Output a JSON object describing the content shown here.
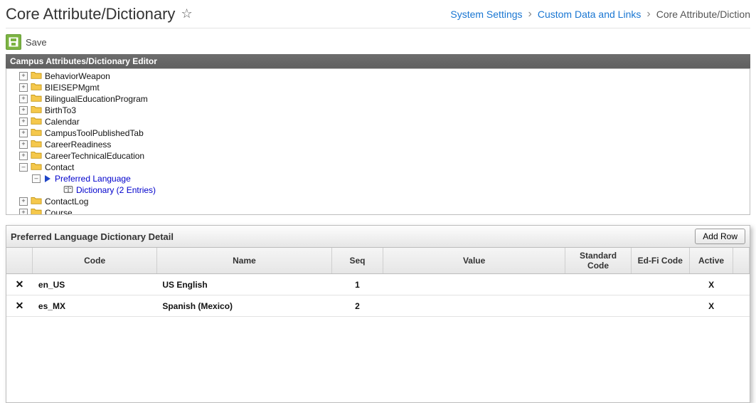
{
  "header": {
    "title": "Core Attribute/Dictionary",
    "breadcrumb": [
      {
        "label": "System Settings",
        "link": true
      },
      {
        "label": "Custom Data and Links",
        "link": true
      },
      {
        "label": "Core Attribute/Diction",
        "link": false
      }
    ]
  },
  "toolbar": {
    "save": "Save"
  },
  "editor": {
    "panel_title": "Campus Attributes/Dictionary Editor"
  },
  "tree": {
    "items": [
      {
        "label": "BehaviorWeapon",
        "type": "folder",
        "expand": "+",
        "indent": 1
      },
      {
        "label": "BIEISEPMgmt",
        "type": "folder",
        "expand": "+",
        "indent": 1
      },
      {
        "label": "BilingualEducationProgram",
        "type": "folder",
        "expand": "+",
        "indent": 1
      },
      {
        "label": "BirthTo3",
        "type": "folder",
        "expand": "+",
        "indent": 1
      },
      {
        "label": "Calendar",
        "type": "folder",
        "expand": "+",
        "indent": 1
      },
      {
        "label": "CampusToolPublishedTab",
        "type": "folder",
        "expand": "+",
        "indent": 1
      },
      {
        "label": "CareerReadiness",
        "type": "folder",
        "expand": "+",
        "indent": 1
      },
      {
        "label": "CareerTechnicalEducation",
        "type": "folder",
        "expand": "+",
        "indent": 1
      },
      {
        "label": "Contact",
        "type": "folder",
        "expand": "–",
        "indent": 1
      },
      {
        "label": "Preferred Language",
        "type": "attr",
        "expand": "–",
        "indent": 2,
        "selected": true
      },
      {
        "label": "Dictionary (2 Entries)",
        "type": "dict",
        "expand": "",
        "indent": 3,
        "selected": true
      },
      {
        "label": "ContactLog",
        "type": "folder",
        "expand": "+",
        "indent": 1
      },
      {
        "label": "Course",
        "type": "folder",
        "expand": "+",
        "indent": 1
      }
    ]
  },
  "detail": {
    "title": "Preferred Language Dictionary Detail",
    "add_row": "Add Row",
    "columns": {
      "code": "Code",
      "name": "Name",
      "seq": "Seq",
      "value": "Value",
      "standard_code": "Standard Code",
      "edfi_code": "Ed-Fi Code",
      "active": "Active"
    },
    "rows": [
      {
        "code": "en_US",
        "name": "US English",
        "seq": "1",
        "value": "",
        "standard_code": "",
        "edfi_code": "",
        "active": "X"
      },
      {
        "code": "es_MX",
        "name": "Spanish (Mexico)",
        "seq": "2",
        "value": "",
        "standard_code": "",
        "edfi_code": "",
        "active": "X"
      }
    ]
  }
}
